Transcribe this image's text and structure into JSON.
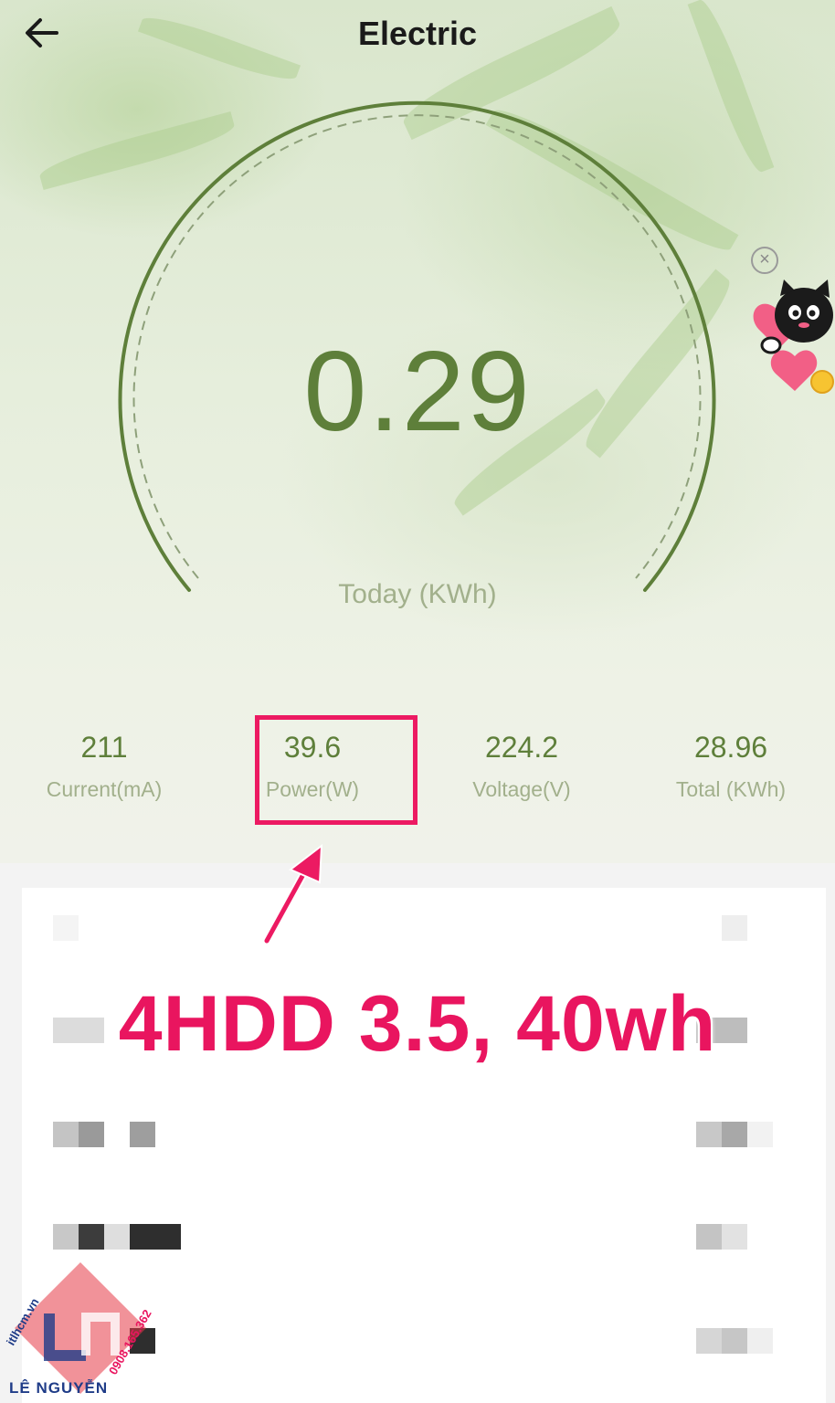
{
  "header": {
    "title": "Electric"
  },
  "gauge": {
    "value": "0.29",
    "label": "Today (KWh)"
  },
  "stats": [
    {
      "value": "211",
      "label": "Current(mA)"
    },
    {
      "value": "39.6",
      "label": "Power(W)"
    },
    {
      "value": "224.2",
      "label": "Voltage(V)"
    },
    {
      "value": "28.96",
      "label": "Total (KWh)"
    }
  ],
  "ad": {
    "close_symbol": "×"
  },
  "annotation": {
    "text": "4HDD 3.5, 40wh"
  },
  "watermark": {
    "name": "LÊ NGUYỄN",
    "site": "itlhcm.vn",
    "phone": "0908.165.362"
  },
  "colors": {
    "accent_green": "#5e7f3a",
    "label_green": "#a2b08c",
    "highlight_pink": "#ec1a62"
  },
  "icons": {
    "back": "arrow-left-icon",
    "close": "close-circle-icon"
  }
}
